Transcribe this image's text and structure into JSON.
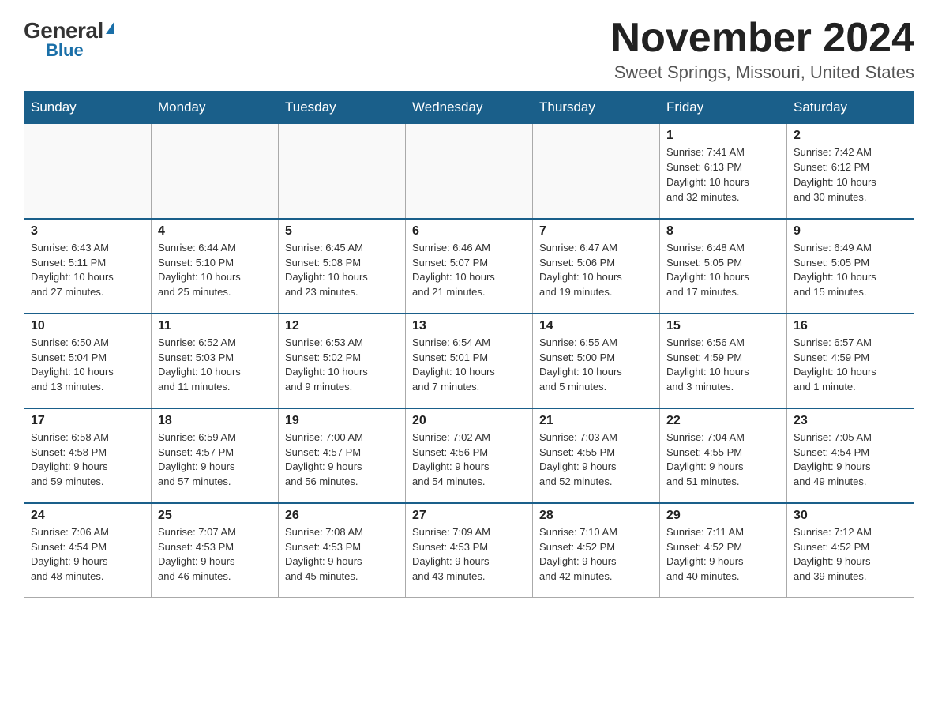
{
  "logo": {
    "general": "General",
    "triangle": "",
    "blue": "Blue"
  },
  "title": {
    "month": "November 2024",
    "location": "Sweet Springs, Missouri, United States"
  },
  "weekdays": [
    "Sunday",
    "Monday",
    "Tuesday",
    "Wednesday",
    "Thursday",
    "Friday",
    "Saturday"
  ],
  "weeks": [
    [
      {
        "day": "",
        "info": ""
      },
      {
        "day": "",
        "info": ""
      },
      {
        "day": "",
        "info": ""
      },
      {
        "day": "",
        "info": ""
      },
      {
        "day": "",
        "info": ""
      },
      {
        "day": "1",
        "info": "Sunrise: 7:41 AM\nSunset: 6:13 PM\nDaylight: 10 hours\nand 32 minutes."
      },
      {
        "day": "2",
        "info": "Sunrise: 7:42 AM\nSunset: 6:12 PM\nDaylight: 10 hours\nand 30 minutes."
      }
    ],
    [
      {
        "day": "3",
        "info": "Sunrise: 6:43 AM\nSunset: 5:11 PM\nDaylight: 10 hours\nand 27 minutes."
      },
      {
        "day": "4",
        "info": "Sunrise: 6:44 AM\nSunset: 5:10 PM\nDaylight: 10 hours\nand 25 minutes."
      },
      {
        "day": "5",
        "info": "Sunrise: 6:45 AM\nSunset: 5:08 PM\nDaylight: 10 hours\nand 23 minutes."
      },
      {
        "day": "6",
        "info": "Sunrise: 6:46 AM\nSunset: 5:07 PM\nDaylight: 10 hours\nand 21 minutes."
      },
      {
        "day": "7",
        "info": "Sunrise: 6:47 AM\nSunset: 5:06 PM\nDaylight: 10 hours\nand 19 minutes."
      },
      {
        "day": "8",
        "info": "Sunrise: 6:48 AM\nSunset: 5:05 PM\nDaylight: 10 hours\nand 17 minutes."
      },
      {
        "day": "9",
        "info": "Sunrise: 6:49 AM\nSunset: 5:05 PM\nDaylight: 10 hours\nand 15 minutes."
      }
    ],
    [
      {
        "day": "10",
        "info": "Sunrise: 6:50 AM\nSunset: 5:04 PM\nDaylight: 10 hours\nand 13 minutes."
      },
      {
        "day": "11",
        "info": "Sunrise: 6:52 AM\nSunset: 5:03 PM\nDaylight: 10 hours\nand 11 minutes."
      },
      {
        "day": "12",
        "info": "Sunrise: 6:53 AM\nSunset: 5:02 PM\nDaylight: 10 hours\nand 9 minutes."
      },
      {
        "day": "13",
        "info": "Sunrise: 6:54 AM\nSunset: 5:01 PM\nDaylight: 10 hours\nand 7 minutes."
      },
      {
        "day": "14",
        "info": "Sunrise: 6:55 AM\nSunset: 5:00 PM\nDaylight: 10 hours\nand 5 minutes."
      },
      {
        "day": "15",
        "info": "Sunrise: 6:56 AM\nSunset: 4:59 PM\nDaylight: 10 hours\nand 3 minutes."
      },
      {
        "day": "16",
        "info": "Sunrise: 6:57 AM\nSunset: 4:59 PM\nDaylight: 10 hours\nand 1 minute."
      }
    ],
    [
      {
        "day": "17",
        "info": "Sunrise: 6:58 AM\nSunset: 4:58 PM\nDaylight: 9 hours\nand 59 minutes."
      },
      {
        "day": "18",
        "info": "Sunrise: 6:59 AM\nSunset: 4:57 PM\nDaylight: 9 hours\nand 57 minutes."
      },
      {
        "day": "19",
        "info": "Sunrise: 7:00 AM\nSunset: 4:57 PM\nDaylight: 9 hours\nand 56 minutes."
      },
      {
        "day": "20",
        "info": "Sunrise: 7:02 AM\nSunset: 4:56 PM\nDaylight: 9 hours\nand 54 minutes."
      },
      {
        "day": "21",
        "info": "Sunrise: 7:03 AM\nSunset: 4:55 PM\nDaylight: 9 hours\nand 52 minutes."
      },
      {
        "day": "22",
        "info": "Sunrise: 7:04 AM\nSunset: 4:55 PM\nDaylight: 9 hours\nand 51 minutes."
      },
      {
        "day": "23",
        "info": "Sunrise: 7:05 AM\nSunset: 4:54 PM\nDaylight: 9 hours\nand 49 minutes."
      }
    ],
    [
      {
        "day": "24",
        "info": "Sunrise: 7:06 AM\nSunset: 4:54 PM\nDaylight: 9 hours\nand 48 minutes."
      },
      {
        "day": "25",
        "info": "Sunrise: 7:07 AM\nSunset: 4:53 PM\nDaylight: 9 hours\nand 46 minutes."
      },
      {
        "day": "26",
        "info": "Sunrise: 7:08 AM\nSunset: 4:53 PM\nDaylight: 9 hours\nand 45 minutes."
      },
      {
        "day": "27",
        "info": "Sunrise: 7:09 AM\nSunset: 4:53 PM\nDaylight: 9 hours\nand 43 minutes."
      },
      {
        "day": "28",
        "info": "Sunrise: 7:10 AM\nSunset: 4:52 PM\nDaylight: 9 hours\nand 42 minutes."
      },
      {
        "day": "29",
        "info": "Sunrise: 7:11 AM\nSunset: 4:52 PM\nDaylight: 9 hours\nand 40 minutes."
      },
      {
        "day": "30",
        "info": "Sunrise: 7:12 AM\nSunset: 4:52 PM\nDaylight: 9 hours\nand 39 minutes."
      }
    ]
  ]
}
